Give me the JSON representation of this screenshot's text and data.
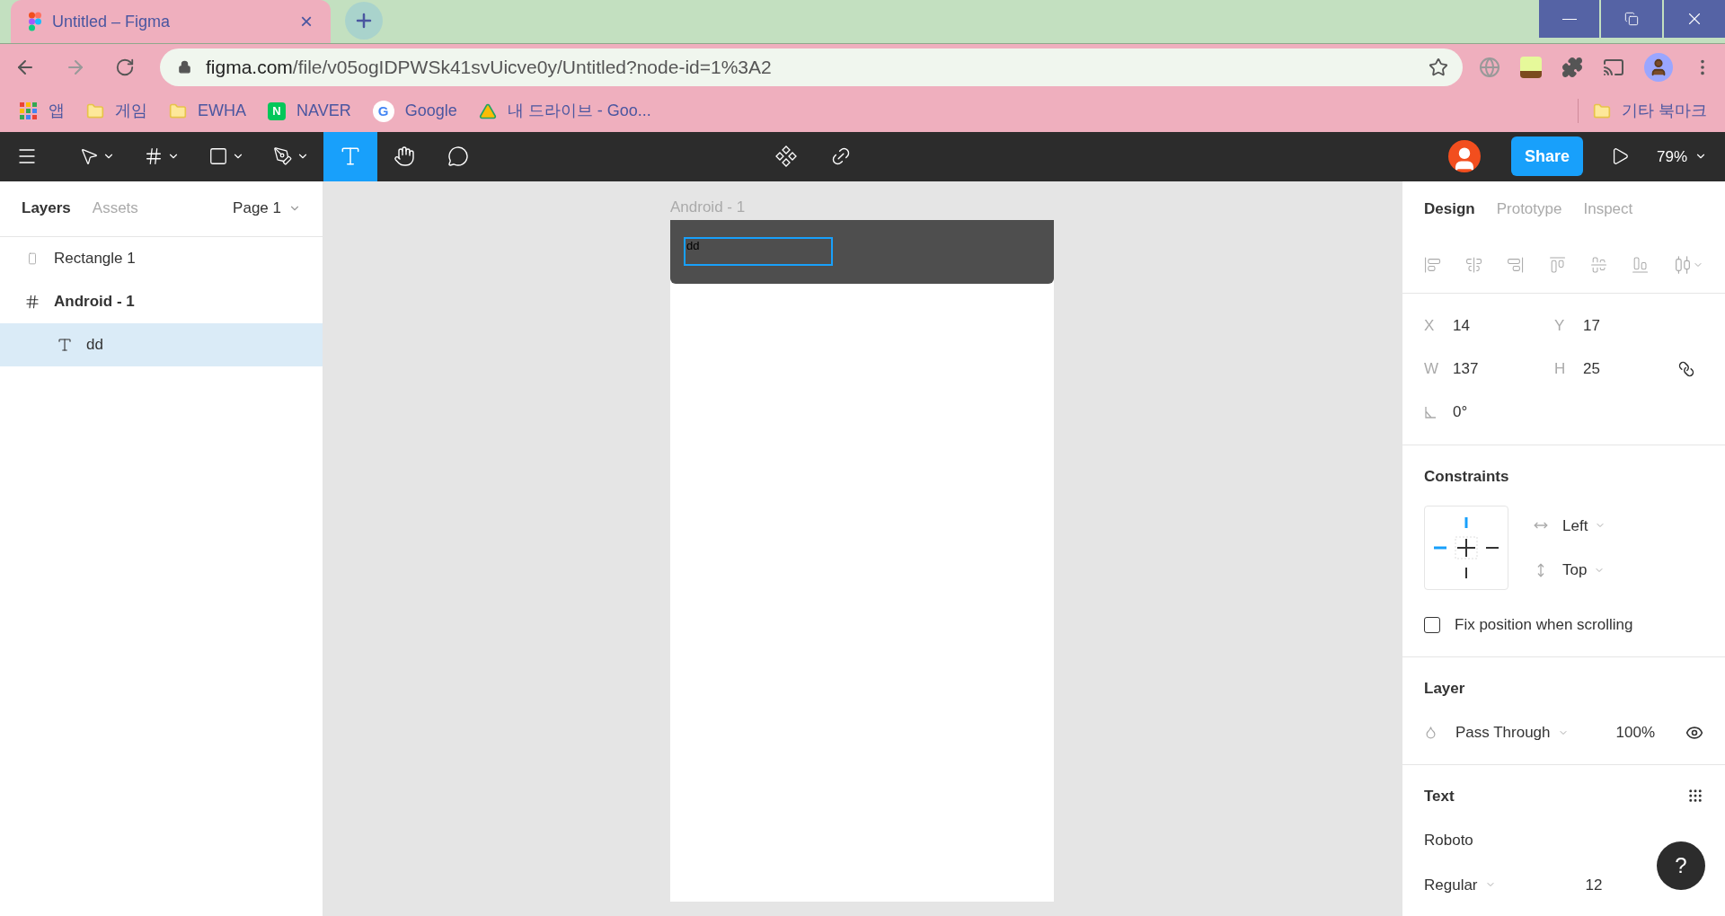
{
  "browser": {
    "tab": {
      "title": "Untitled – Figma",
      "close": "×"
    },
    "url": {
      "domain": "figma.com",
      "path": "/file/v05ogIDPWSk41svUicve0y/Untitled?node-id=1%3A2"
    },
    "bookmarks": [
      {
        "label": "앱",
        "kind": "apps"
      },
      {
        "label": "게임",
        "kind": "folder"
      },
      {
        "label": "EWHA",
        "kind": "folder"
      },
      {
        "label": "NAVER",
        "kind": "naver",
        "icon_text": "N"
      },
      {
        "label": "Google",
        "kind": "google",
        "icon_text": "G"
      },
      {
        "label": "내 드라이브 - Goo...",
        "kind": "drive"
      }
    ],
    "other_bookmarks": "기타 북마크"
  },
  "toolbar": {
    "tools": [
      {
        "kind": "move",
        "selected": false,
        "has_menu": true
      },
      {
        "kind": "frame",
        "selected": false,
        "has_menu": true
      },
      {
        "kind": "rectangle",
        "selected": false,
        "has_menu": true
      },
      {
        "kind": "pen",
        "selected": false,
        "has_menu": true
      },
      {
        "kind": "text",
        "selected": true,
        "has_menu": false
      },
      {
        "kind": "hand",
        "selected": false,
        "has_menu": false
      },
      {
        "kind": "comment",
        "selected": false,
        "has_menu": false
      }
    ],
    "share": "Share",
    "zoom": "79%"
  },
  "left_panel": {
    "tabs": [
      {
        "label": "Layers",
        "selected": true
      },
      {
        "label": "Assets",
        "selected": false
      }
    ],
    "page": "Page 1",
    "layers": [
      {
        "name": "Rectangle 1",
        "kind": "rectangle",
        "selected": false
      },
      {
        "name": "Android - 1",
        "kind": "frame",
        "selected": false,
        "children": [
          {
            "name": "dd",
            "kind": "text",
            "selected": true
          }
        ]
      }
    ]
  },
  "canvas": {
    "frame_label": "Android - 1",
    "text": "dd"
  },
  "right_panel": {
    "tabs": [
      {
        "label": "Design",
        "selected": true
      },
      {
        "label": "Prototype",
        "selected": false
      },
      {
        "label": "Inspect",
        "selected": false
      }
    ],
    "position": [
      {
        "label": "X",
        "value": "14"
      },
      {
        "label": "Y",
        "value": "17"
      },
      {
        "label": "W",
        "value": "137"
      },
      {
        "label": "H",
        "value": "25"
      }
    ],
    "rotation": "0°",
    "constraints": {
      "title": "Constraints",
      "horizontal": "Left",
      "vertical": "Top"
    },
    "fix_position": {
      "label": "Fix position when scrolling",
      "checked": false
    },
    "layer": {
      "title": "Layer",
      "blend": "Pass Through",
      "opacity": "100%"
    },
    "text": {
      "title": "Text",
      "font": "Roboto",
      "style": "Regular",
      "size": "12"
    },
    "help": "?"
  }
}
